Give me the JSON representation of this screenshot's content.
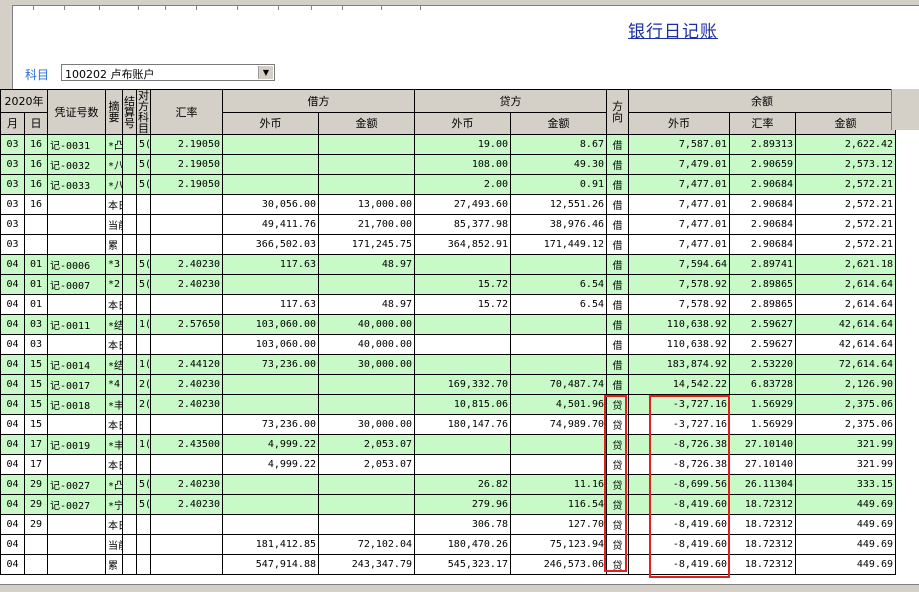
{
  "title": "银行日记账",
  "account": {
    "label": "科目",
    "value": "100202 卢布账户"
  },
  "headers": {
    "year": "2020年",
    "month": "月",
    "day": "日",
    "voucher": "凭证号数",
    "summary": "摘要",
    "settle": "结算号",
    "offset": "对方科目",
    "rate": "汇率",
    "debit": "借方",
    "credit": "贷方",
    "direction": "方向",
    "balance": "余额",
    "foreign": "外币",
    "amount": "金额",
    "bal_rate": "汇率"
  },
  "rows": [
    {
      "hl": 1,
      "m": "03",
      "d": "16",
      "v": "记-0031",
      "s": "*凸",
      "st": "",
      "o": "5(",
      "r": "2.19050",
      "df": "",
      "da": "",
      "cf": "19.00",
      "ca": "8.67",
      "dir": "借",
      "bf": "7,587.01",
      "br": "2.89313",
      "ba": "2,622.42"
    },
    {
      "hl": 1,
      "m": "03",
      "d": "16",
      "v": "记-0032",
      "s": "*八",
      "st": "",
      "o": "5(",
      "r": "2.19050",
      "df": "",
      "da": "",
      "cf": "108.00",
      "ca": "49.30",
      "dir": "借",
      "bf": "7,479.01",
      "br": "2.90659",
      "ba": "2,573.12"
    },
    {
      "hl": 1,
      "m": "03",
      "d": "16",
      "v": "记-0033",
      "s": "*八",
      "st": "",
      "o": "5(",
      "r": "2.19050",
      "df": "",
      "da": "",
      "cf": "2.00",
      "ca": "0.91",
      "dir": "借",
      "bf": "7,477.01",
      "br": "2.90684",
      "ba": "2,572.21"
    },
    {
      "hl": 0,
      "m": "03",
      "d": "16",
      "v": "",
      "s": "本日",
      "st": "",
      "o": "",
      "r": "",
      "df": "30,056.00",
      "da": "13,000.00",
      "cf": "27,493.60",
      "ca": "12,551.26",
      "dir": "借",
      "bf": "7,477.01",
      "br": "2.90684",
      "ba": "2,572.21"
    },
    {
      "hl": 0,
      "m": "03",
      "d": "",
      "v": "",
      "s": "当前",
      "st": "",
      "o": "",
      "r": "",
      "df": "49,411.76",
      "da": "21,700.00",
      "cf": "85,377.98",
      "ca": "38,976.46",
      "dir": "借",
      "bf": "7,477.01",
      "br": "2.90684",
      "ba": "2,572.21"
    },
    {
      "hl": 0,
      "m": "03",
      "d": "",
      "v": "",
      "s": "累",
      "st": "",
      "o": "",
      "r": "",
      "df": "366,502.03",
      "da": "171,245.75",
      "cf": "364,852.91",
      "ca": "171,449.12",
      "dir": "借",
      "bf": "7,477.01",
      "br": "2.90684",
      "ba": "2,572.21"
    },
    {
      "hl": 1,
      "m": "04",
      "d": "01",
      "v": "记-0006",
      "s": "*3",
      "st": "",
      "o": "5(",
      "r": "2.40230",
      "df": "117.63",
      "da": "48.97",
      "cf": "",
      "ca": "",
      "dir": "借",
      "bf": "7,594.64",
      "br": "2.89741",
      "ba": "2,621.18"
    },
    {
      "hl": 1,
      "m": "04",
      "d": "01",
      "v": "记-0007",
      "s": "*2",
      "st": "",
      "o": "5(",
      "r": "2.40230",
      "df": "",
      "da": "",
      "cf": "15.72",
      "ca": "6.54",
      "dir": "借",
      "bf": "7,578.92",
      "br": "2.89865",
      "ba": "2,614.64"
    },
    {
      "hl": 0,
      "m": "04",
      "d": "01",
      "v": "",
      "s": "本日",
      "st": "",
      "o": "",
      "r": "",
      "df": "117.63",
      "da": "48.97",
      "cf": "15.72",
      "ca": "6.54",
      "dir": "借",
      "bf": "7,578.92",
      "br": "2.89865",
      "ba": "2,614.64"
    },
    {
      "hl": 1,
      "m": "04",
      "d": "03",
      "v": "记-0011",
      "s": "*结",
      "st": "",
      "o": "1(",
      "r": "2.57650",
      "df": "103,060.00",
      "da": "40,000.00",
      "cf": "",
      "ca": "",
      "dir": "借",
      "bf": "110,638.92",
      "br": "2.59627",
      "ba": "42,614.64"
    },
    {
      "hl": 0,
      "m": "04",
      "d": "03",
      "v": "",
      "s": "本日",
      "st": "",
      "o": "",
      "r": "",
      "df": "103,060.00",
      "da": "40,000.00",
      "cf": "",
      "ca": "",
      "dir": "借",
      "bf": "110,638.92",
      "br": "2.59627",
      "ba": "42,614.64"
    },
    {
      "hl": 1,
      "m": "04",
      "d": "15",
      "v": "记-0014",
      "s": "*结",
      "st": "",
      "o": "1(",
      "r": "2.44120",
      "df": "73,236.00",
      "da": "30,000.00",
      "cf": "",
      "ca": "",
      "dir": "借",
      "bf": "183,874.92",
      "br": "2.53220",
      "ba": "72,614.64"
    },
    {
      "hl": 1,
      "m": "04",
      "d": "15",
      "v": "记-0017",
      "s": "*4",
      "st": "",
      "o": "2(",
      "r": "2.40230",
      "df": "",
      "da": "",
      "cf": "169,332.70",
      "ca": "70,487.74",
      "dir": "借",
      "bf": "14,542.22",
      "br": "6.83728",
      "ba": "2,126.90"
    },
    {
      "hl": 1,
      "m": "04",
      "d": "15",
      "v": "记-0018",
      "s": "*丰",
      "st": "",
      "o": "2(",
      "r": "2.40230",
      "df": "",
      "da": "",
      "cf": "10,815.06",
      "ca": "4,501.96",
      "dir": "贷",
      "bf": "-3,727.16",
      "br": "1.56929",
      "ba": "2,375.06"
    },
    {
      "hl": 0,
      "m": "04",
      "d": "15",
      "v": "",
      "s": "本日",
      "st": "",
      "o": "",
      "r": "",
      "df": "73,236.00",
      "da": "30,000.00",
      "cf": "180,147.76",
      "ca": "74,989.70",
      "dir": "贷",
      "bf": "-3,727.16",
      "br": "1.56929",
      "ba": "2,375.06"
    },
    {
      "hl": 1,
      "m": "04",
      "d": "17",
      "v": "记-0019",
      "s": "*丰",
      "st": "",
      "o": "1(",
      "r": "2.43500",
      "df": "4,999.22",
      "da": "2,053.07",
      "cf": "",
      "ca": "",
      "dir": "贷",
      "bf": "-8,726.38",
      "br": "27.10140",
      "ba": "321.99"
    },
    {
      "hl": 0,
      "m": "04",
      "d": "17",
      "v": "",
      "s": "本日",
      "st": "",
      "o": "",
      "r": "",
      "df": "4,999.22",
      "da": "2,053.07",
      "cf": "",
      "ca": "",
      "dir": "贷",
      "bf": "-8,726.38",
      "br": "27.10140",
      "ba": "321.99"
    },
    {
      "hl": 1,
      "m": "04",
      "d": "29",
      "v": "记-0027",
      "s": "*凸",
      "st": "",
      "o": "5(",
      "r": "2.40230",
      "df": "",
      "da": "",
      "cf": "26.82",
      "ca": "11.16",
      "dir": "贷",
      "bf": "-8,699.56",
      "br": "26.11304",
      "ba": "333.15"
    },
    {
      "hl": 1,
      "m": "04",
      "d": "29",
      "v": "记-0027",
      "s": "*宁",
      "st": "",
      "o": "5(",
      "r": "2.40230",
      "df": "",
      "da": "",
      "cf": "279.96",
      "ca": "116.54",
      "dir": "贷",
      "bf": "-8,419.60",
      "br": "18.72312",
      "ba": "449.69"
    },
    {
      "hl": 0,
      "m": "04",
      "d": "29",
      "v": "",
      "s": "本日",
      "st": "",
      "o": "",
      "r": "",
      "df": "",
      "da": "",
      "cf": "306.78",
      "ca": "127.70",
      "dir": "贷",
      "bf": "-8,419.60",
      "br": "18.72312",
      "ba": "449.69"
    },
    {
      "hl": 0,
      "m": "04",
      "d": "",
      "v": "",
      "s": "当前",
      "st": "",
      "o": "",
      "r": "",
      "df": "181,412.85",
      "da": "72,102.04",
      "cf": "180,470.26",
      "ca": "75,123.94",
      "dir": "贷",
      "bf": "-8,419.60",
      "br": "18.72312",
      "ba": "449.69"
    },
    {
      "hl": 0,
      "m": "04",
      "d": "",
      "v": "",
      "s": "累",
      "st": "",
      "o": "",
      "r": "",
      "df": "547,914.88",
      "da": "243,347.79",
      "cf": "545,323.17",
      "ca": "246,573.06",
      "dir": "贷",
      "bf": "-8,419.60",
      "br": "18.72312",
      "ba": "449.69"
    }
  ]
}
